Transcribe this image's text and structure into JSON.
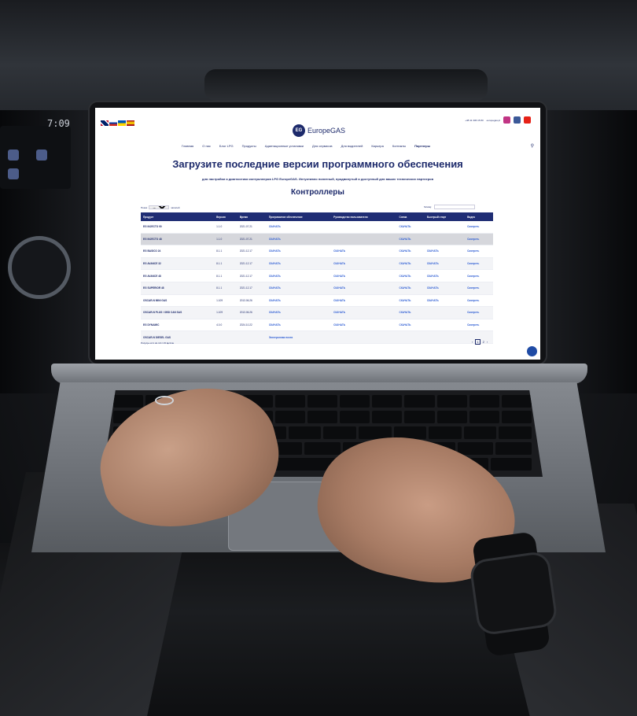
{
  "site": {
    "logo_mark": "EG",
    "logo_text": "EuropeGAS",
    "contact_phone": "+48 41 306 15 80",
    "contact_email": "europegas.pl",
    "nav": [
      "Главная",
      "О нас",
      "Блог LPG",
      "Продукты",
      "Адаптационные установки",
      "Для сервисов",
      "Для водителей",
      "Карьера",
      "Контакты",
      "Партнеры"
    ],
    "headline": "Загрузите последние версии программного обеспечения",
    "subline": "для настройки и диагностики контроллеров LPG EuropeGAS. Интуитивно понятный, продвинутый и доступный для ваших технических партнеров",
    "section_title": "Контроллеры",
    "show_label": "Показ",
    "show_value": "10",
    "show_suffix": "записей",
    "search_label": "Szukaj:",
    "table": {
      "headers": [
        "Продукт",
        "Версия",
        "Время",
        "Программное обеспечение",
        "Руководство пользователя",
        "Схема",
        "Быстрый старт",
        "Видео"
      ],
      "rows": [
        [
          "EG INJECTO 90",
          "1.1.0",
          "2021.07.21",
          "СКАЧАТЬ",
          "",
          "СКАЧАТЬ",
          "",
          "Смотреть"
        ],
        [
          "EG INJECTO 48",
          "1.1.0",
          "2021.07.21",
          "СКАЧАТЬ",
          "",
          "СКАЧАТЬ",
          "",
          "Смотреть"
        ],
        [
          "EG BASICO 24",
          "8.1.1",
          "2021.12.17",
          "СКАЧАТЬ",
          "СКАЧАТЬ",
          "СКАЧАТЬ",
          "СКАЧАТЬ",
          "Смотреть"
        ],
        [
          "EG AVANCE 32",
          "8.1.1",
          "2021.12.17",
          "СКАЧАТЬ",
          "СКАЧАТЬ",
          "СКАЧАТЬ",
          "СКАЧАТЬ",
          "Смотреть"
        ],
        [
          "EG AVANCE 48",
          "8.1.1",
          "2021.12.17",
          "СКАЧАТЬ",
          "СКАЧАТЬ",
          "СКАЧАТЬ",
          "СКАЧАТЬ",
          "Смотреть"
        ],
        [
          "EG SUPERIOR 48",
          "8.1.1",
          "2021.12.17",
          "СКАЧАТЬ",
          "СКАЧАТЬ",
          "СКАЧАТЬ",
          "СКАЧАТЬ",
          "Смотреть"
        ],
        [
          "OSCAR-N MINI GAS",
          "1.109",
          "2013.06.26",
          "СКАЧАТЬ",
          "СКАЧАТЬ",
          "СКАЧАТЬ",
          "СКАЧАТЬ",
          "Смотреть"
        ],
        [
          "OSCAR-N PLUS / OBD CAN SAS",
          "1.109",
          "2013.06.26",
          "СКАЧАТЬ",
          "СКАЧАТЬ",
          "СКАЧАТЬ",
          "",
          "Смотреть"
        ],
        [
          "EG DYNAMIC",
          "4.0.0",
          "2024.10.22",
          "СКАЧАТЬ",
          "СКАЧАТЬ",
          "СКАЧАТЬ",
          "",
          "Смотреть"
        ],
        [
          "OSCAR-N DIESEL GAS",
          "",
          "",
          "Электронная почта",
          "",
          "",
          "",
          ""
        ]
      ]
    },
    "info": "Pozycje od 1 do 10 z 15 łącznie",
    "pager": [
      "‹",
      "1",
      "2",
      "›"
    ]
  },
  "car": {
    "clock": "7:09"
  },
  "colors": {
    "brand": "#1d2a6b",
    "header": "#1f2d74",
    "link": "#2b5bd3"
  }
}
